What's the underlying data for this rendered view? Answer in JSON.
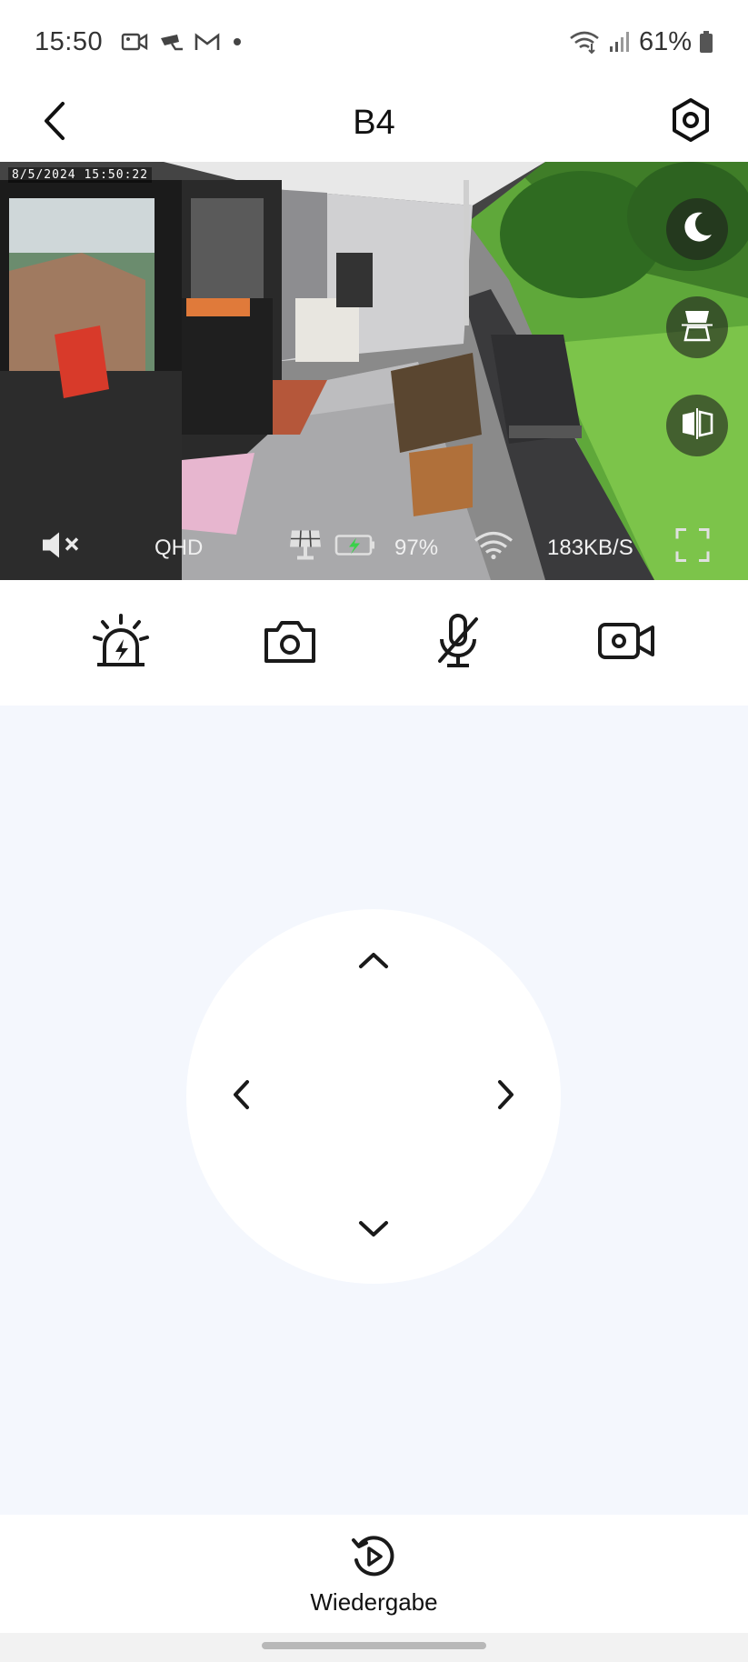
{
  "status_bar": {
    "time": "15:50",
    "battery_percent": "61%",
    "notification_icons": [
      "video-camera-icon",
      "cctv-icon",
      "gmail-icon",
      "dot-icon"
    ],
    "system_icons": [
      "wifi-icon",
      "signal-icon",
      "battery-icon"
    ]
  },
  "header": {
    "title": "B4",
    "back_icon": "chevron-left-icon",
    "settings_icon": "hexagon-gear-icon"
  },
  "video": {
    "timestamp": "8/5/2024 15:50:22",
    "side_buttons": [
      "night-mode-icon",
      "flip-vertical-icon",
      "mirror-icon"
    ],
    "overlay": {
      "mute_icon": "speaker-muted-icon",
      "quality": "QHD",
      "solar_icon": "solar-panel-icon",
      "battery_icon": "battery-charging-icon",
      "battery_level": "97%",
      "wifi_icon": "wifi-icon",
      "bitrate": "183KB/S",
      "fullscreen_icon": "fullscreen-icon"
    }
  },
  "controls": [
    {
      "name": "siren-button",
      "icon": "siren-icon"
    },
    {
      "name": "snapshot-button",
      "icon": "camera-icon"
    },
    {
      "name": "microphone-button",
      "icon": "microphone-muted-icon"
    },
    {
      "name": "record-button",
      "icon": "video-record-icon"
    }
  ],
  "ptz": {
    "up_icon": "chevron-up-icon",
    "down_icon": "chevron-down-icon",
    "left_icon": "chevron-left-icon",
    "right_icon": "chevron-right-icon"
  },
  "bottom": {
    "playback_label": "Wiedergabe",
    "playback_icon": "replay-icon"
  },
  "colors": {
    "ptz_background": "#f4f7fd",
    "charging_green": "#3bd14a",
    "icon_dark": "#1a1a1a"
  }
}
